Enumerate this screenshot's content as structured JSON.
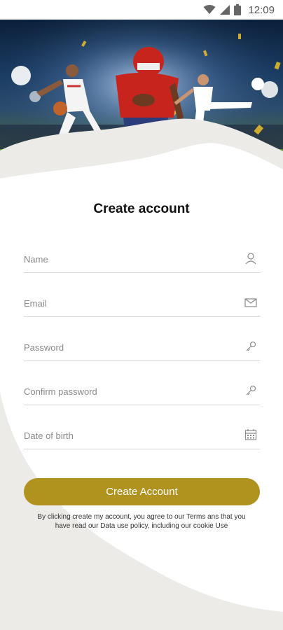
{
  "status_bar": {
    "time": "12:09",
    "icons": [
      "wifi-icon",
      "signal-icon",
      "battery-icon"
    ]
  },
  "hero": {
    "description_icon": "sports-banner-image"
  },
  "form": {
    "title": "Create account",
    "fields": [
      {
        "placeholder": "Name",
        "value": "",
        "icon": "person-icon"
      },
      {
        "placeholder": "Email",
        "value": "",
        "icon": "envelope-icon"
      },
      {
        "placeholder": "Password",
        "value": "",
        "icon": "key-icon"
      },
      {
        "placeholder": "Confirm password",
        "value": "",
        "icon": "key-icon"
      },
      {
        "placeholder": "Date of birth",
        "value": "",
        "icon": "calendar-icon"
      }
    ],
    "submit_label": "Create Account",
    "legal": "By clicking create my account, you agree to our Terms ans that you have read our Data use policy, including our cookie Use"
  },
  "colors": {
    "accent": "#b0931e",
    "background_wave": "#ecebe7"
  }
}
